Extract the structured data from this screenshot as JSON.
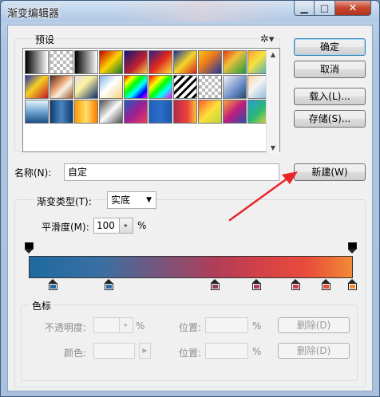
{
  "window": {
    "title": "渐变编辑器",
    "minimize_glyph": "▁",
    "maximize_glyph": "□",
    "close_glyph": "✕"
  },
  "presets": {
    "label": "预设",
    "menu_icon": "gear-icon"
  },
  "buttons": {
    "ok": "确定",
    "cancel": "取消",
    "load": "载入(L)...",
    "save": "存储(S)...",
    "new": "新建(W)"
  },
  "name_row": {
    "label": "名称(N):",
    "value": "自定"
  },
  "gradient": {
    "type_label": "渐变类型(T):",
    "type_value": "实底",
    "smoothness_label": "平滑度(M):",
    "smoothness_value": "100",
    "smoothness_unit": "%",
    "colors": [
      "#1e6aa0",
      "#3a6fa3",
      "#b23d57",
      "#d44247",
      "#e94c3b",
      "#f28a36"
    ]
  },
  "color_stops_group": {
    "label": "色标",
    "opacity_label": "不透明度:",
    "opacity_unit": "%",
    "position_label_1": "位置:",
    "position_unit_1": "%",
    "delete_label_1": "删除(D)",
    "color_label": "颜色:",
    "position_label_2": "位置:",
    "position_unit_2": "%",
    "delete_label_2": "删除(D)"
  },
  "annotation": {
    "arrow_color": "#e8232a"
  }
}
